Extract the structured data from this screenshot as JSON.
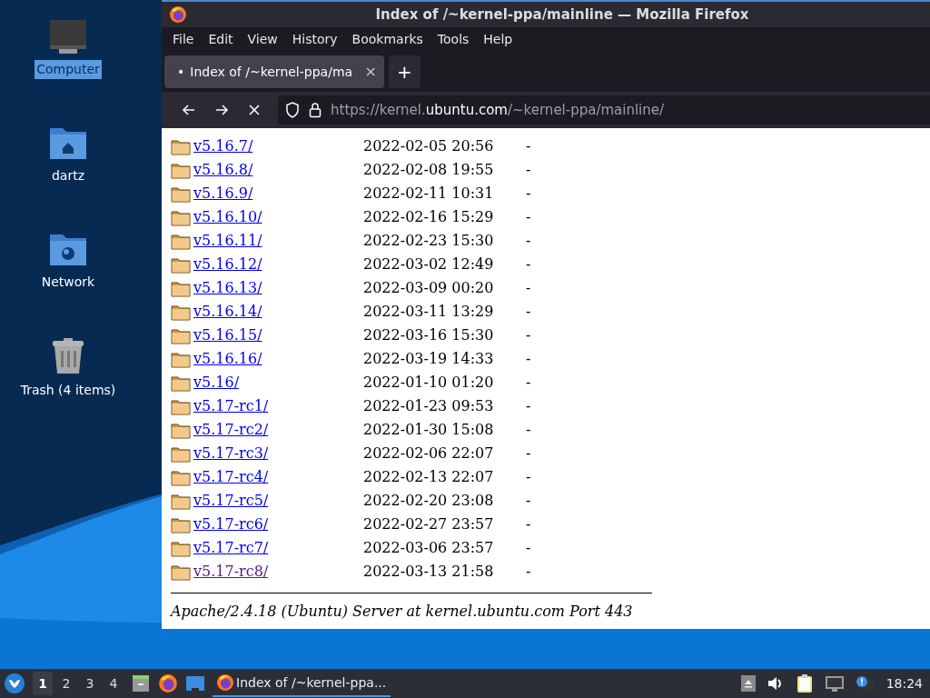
{
  "desktop_icons": [
    {
      "kind": "computer",
      "label": "Computer",
      "selected": true
    },
    {
      "kind": "home",
      "label": "dartz",
      "selected": false
    },
    {
      "kind": "network",
      "label": "Network",
      "selected": false
    },
    {
      "kind": "trash",
      "label": "Trash (4 items)",
      "selected": false
    }
  ],
  "window": {
    "title": "Index of /~kernel-ppa/mainline — Mozilla Firefox",
    "menu": [
      "File",
      "Edit",
      "View",
      "History",
      "Bookmarks",
      "Tools",
      "Help"
    ],
    "tabs": [
      {
        "dot": "•",
        "label": "Index of /~kernel-ppa/ma",
        "close": "×",
        "selected": true
      }
    ],
    "new_tab": "+",
    "url": {
      "scheme": "https://kernel.",
      "domain": "ubuntu.com",
      "path": "/~kernel-ppa/mainline/"
    },
    "listing": [
      {
        "name": "v5.16.7/",
        "date": "2022-02-05 20:56",
        "size": "-",
        "visited": false
      },
      {
        "name": "v5.16.8/",
        "date": "2022-02-08 19:55",
        "size": "-",
        "visited": false
      },
      {
        "name": "v5.16.9/",
        "date": "2022-02-11 10:31",
        "size": "-",
        "visited": false
      },
      {
        "name": "v5.16.10/",
        "date": "2022-02-16 15:29",
        "size": "-",
        "visited": false
      },
      {
        "name": "v5.16.11/",
        "date": "2022-02-23 15:30",
        "size": "-",
        "visited": false
      },
      {
        "name": "v5.16.12/",
        "date": "2022-03-02 12:49",
        "size": "-",
        "visited": false
      },
      {
        "name": "v5.16.13/",
        "date": "2022-03-09 00:20",
        "size": "-",
        "visited": false
      },
      {
        "name": "v5.16.14/",
        "date": "2022-03-11 13:29",
        "size": "-",
        "visited": false
      },
      {
        "name": "v5.16.15/",
        "date": "2022-03-16 15:30",
        "size": "-",
        "visited": false
      },
      {
        "name": "v5.16.16/",
        "date": "2022-03-19 14:33",
        "size": "-",
        "visited": false
      },
      {
        "name": "v5.16/",
        "date": "2022-01-10 01:20",
        "size": "-",
        "visited": false
      },
      {
        "name": "v5.17-rc1/",
        "date": "2022-01-23 09:53",
        "size": "-",
        "visited": false
      },
      {
        "name": "v5.17-rc2/",
        "date": "2022-01-30 15:08",
        "size": "-",
        "visited": false
      },
      {
        "name": "v5.17-rc3/",
        "date": "2022-02-06 22:07",
        "size": "-",
        "visited": false
      },
      {
        "name": "v5.17-rc4/",
        "date": "2022-02-13 22:07",
        "size": "-",
        "visited": false
      },
      {
        "name": "v5.17-rc5/",
        "date": "2022-02-20 23:08",
        "size": "-",
        "visited": false
      },
      {
        "name": "v5.17-rc6/",
        "date": "2022-02-27 23:57",
        "size": "-",
        "visited": false
      },
      {
        "name": "v5.17-rc7/",
        "date": "2022-03-06 23:57",
        "size": "-",
        "visited": false
      },
      {
        "name": "v5.17-rc8/",
        "date": "2022-03-13 21:58",
        "size": "-",
        "visited": true
      }
    ],
    "footer": "Apache/2.4.18 (Ubuntu) Server at kernel.ubuntu.com Port 443"
  },
  "taskbar": {
    "workspaces": [
      {
        "label": "1",
        "selected": true
      },
      {
        "label": "2",
        "selected": false
      },
      {
        "label": "3",
        "selected": false
      },
      {
        "label": "4",
        "selected": false
      }
    ],
    "tasks": [
      {
        "label": "Index of /~kernel-ppa...",
        "selected": true
      }
    ],
    "clock": "18:24"
  }
}
